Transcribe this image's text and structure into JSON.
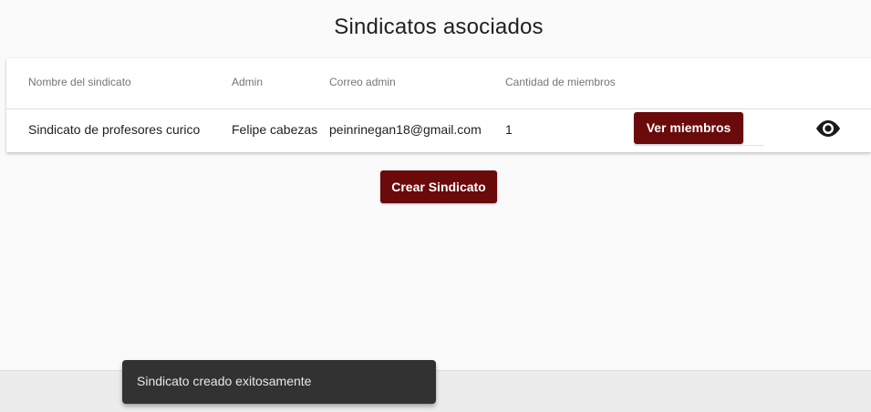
{
  "page": {
    "title": "Sindicatos asociados"
  },
  "table": {
    "columns": [
      "Nombre del sindicato",
      "Admin",
      "Correo admin",
      "Cantidad de miembros"
    ],
    "rows": [
      {
        "nombre": "Sindicato de profesores curico",
        "admin": "Felipe cabezas",
        "correo": "peinrinegan18@gmail.com",
        "cantidad": "1",
        "ver_label": "Ver miembros",
        "view_icon": "eye-icon"
      }
    ]
  },
  "actions": {
    "crear_label": "Crear Sindicato"
  },
  "snackbar": {
    "message": "Sindicato creado exitosamente"
  },
  "colors": {
    "primary_button": "#6b0a0a",
    "snackbar_bg": "#323232"
  }
}
